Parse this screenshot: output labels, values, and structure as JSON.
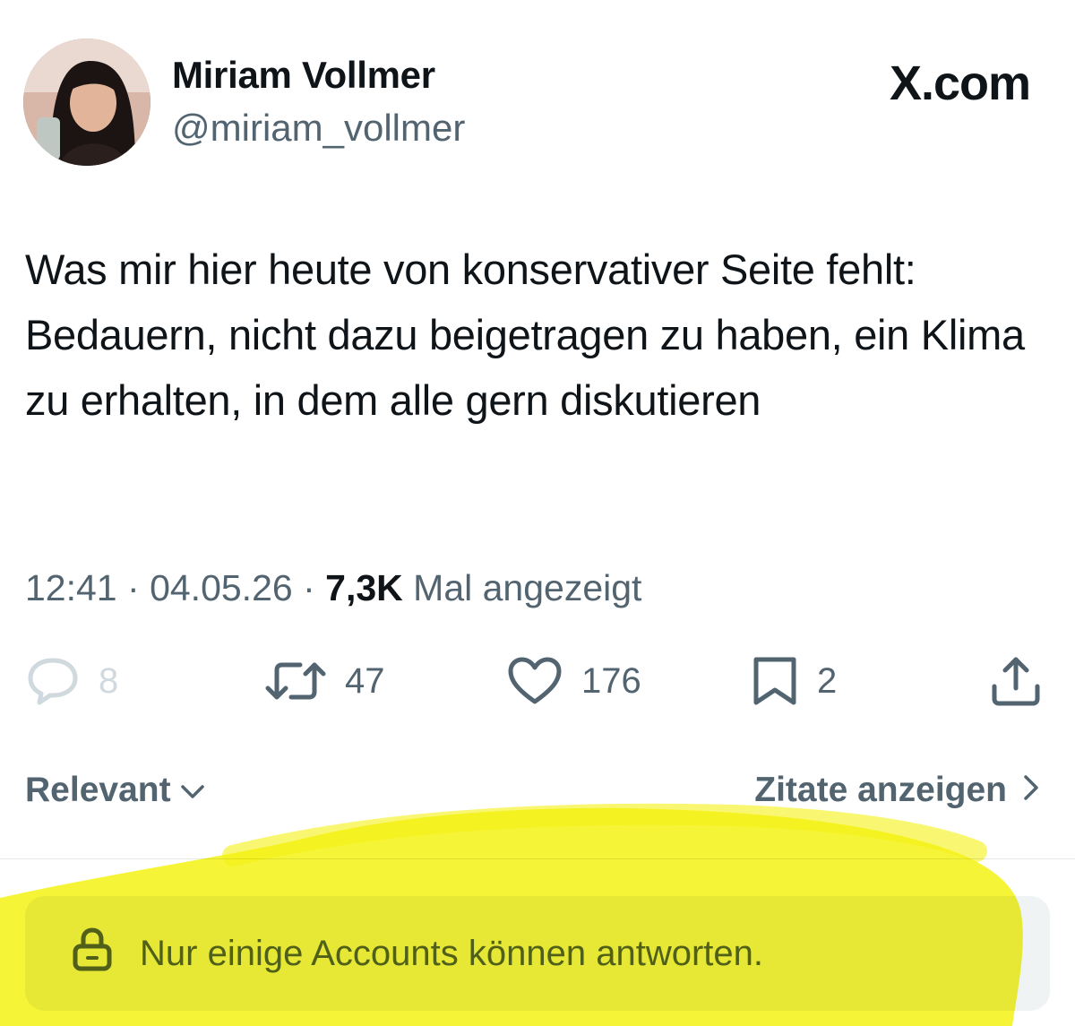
{
  "author": {
    "display_name": "Miriam Vollmer",
    "handle": "@miriam_vollmer"
  },
  "brand": "X.com",
  "tweet": {
    "text": "Was mir hier heute von konservativer Seite fehlt: Bedauern, nicht dazu beigetragen zu haben, ein Klima zu erhalten, in dem alle gern diskutieren"
  },
  "meta": {
    "time": "12:41",
    "separator": "·",
    "date": "04.05.26",
    "views_count": "7,3K",
    "views_label": "Mal angezeigt"
  },
  "actions": {
    "replies": "8",
    "reposts": "47",
    "likes": "176",
    "bookmarks": "2"
  },
  "sort": {
    "label": "Relevant"
  },
  "quotes": {
    "label": "Zitate anzeigen"
  },
  "reply_restriction": {
    "text": "Nur einige Accounts können antworten."
  },
  "icons": {
    "reply": "speech-bubble-icon",
    "repost": "repost-arrows-icon",
    "like": "heart-icon",
    "bookmark": "bookmark-icon",
    "share": "share-icon",
    "sort": "chevron-down-icon",
    "quotes": "chevron-right-icon",
    "lock": "lock-icon"
  },
  "colors": {
    "text_primary": "#0f1419",
    "text_secondary": "#536471",
    "disabled": "#cfd9de",
    "highlighter": "#f5f214"
  }
}
